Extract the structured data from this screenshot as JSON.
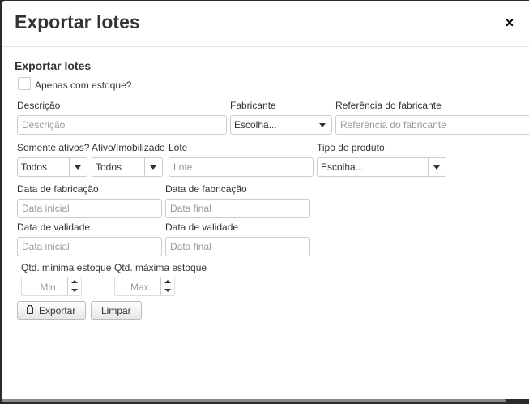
{
  "dialog": {
    "title": "Exportar lotes",
    "close_glyph": "×",
    "close_icon": "close-icon"
  },
  "form": {
    "subtitle": "Exportar lotes",
    "only_stock": {
      "label": "Apenas com estoque?",
      "checked": false
    },
    "descricao": {
      "label": "Descrição",
      "placeholder": "Descrição",
      "value": ""
    },
    "fabricante": {
      "label": "Fabricante",
      "selected": "Escolha..."
    },
    "referencia": {
      "label": "Referência do fabricante",
      "placeholder": "Referência do fabricante",
      "value": ""
    },
    "somente_ativos": {
      "label": "Somente ativos?",
      "selected": "Todos"
    },
    "ativo_imobilizado": {
      "label": "Ativo/Imobilizado",
      "selected": "Todos"
    },
    "lote": {
      "label": "Lote",
      "placeholder": "Lote",
      "value": ""
    },
    "tipo_produto": {
      "label": "Tipo de produto",
      "selected": "Escolha..."
    },
    "fab_inicial": {
      "label": "Data de fabricação",
      "placeholder": "Data inicial",
      "value": ""
    },
    "fab_final": {
      "label": "Data de fabricação",
      "placeholder": "Data final",
      "value": ""
    },
    "val_inicial": {
      "label": "Data de validade",
      "placeholder": "Data inicial",
      "value": ""
    },
    "val_final": {
      "label": "Data de validade",
      "placeholder": "Data final",
      "value": ""
    },
    "qtd_min": {
      "label": "Qtd. mínima estoque",
      "placeholder": "Min."
    },
    "qtd_max": {
      "label": "Qtd. máxima estoque",
      "placeholder": "Max."
    }
  },
  "actions": {
    "export_label": "Exportar",
    "export_icon": "clipboard-icon",
    "clear_label": "Limpar"
  },
  "colors": {
    "backdrop": "#2b2b2b",
    "border": "#cccccc",
    "placeholder": "#999999",
    "text": "#333333"
  }
}
